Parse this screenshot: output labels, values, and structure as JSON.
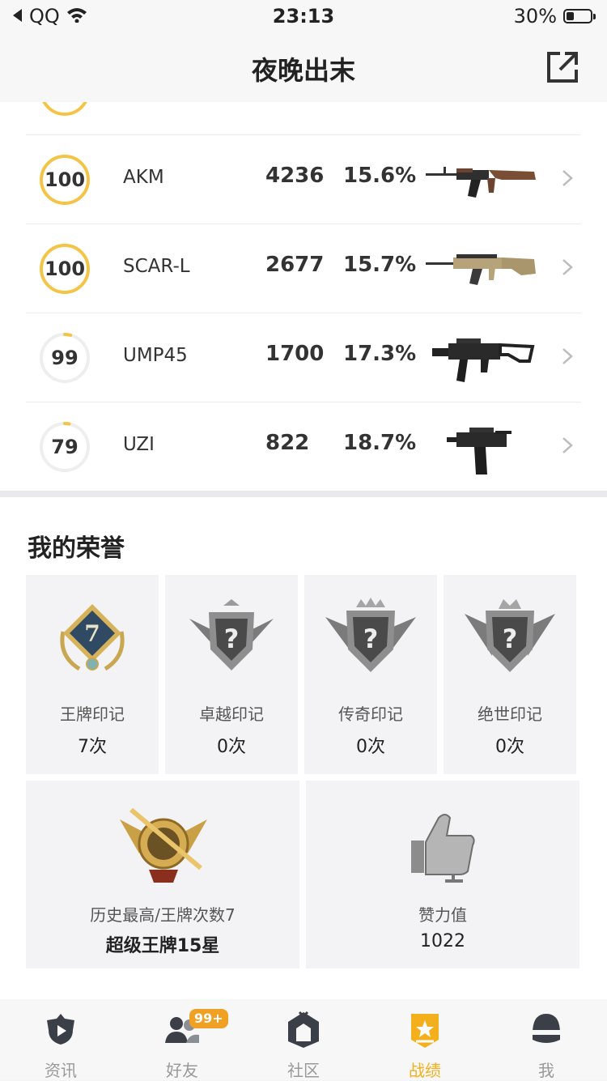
{
  "status_bar": {
    "carrier": "QQ",
    "time": "23:13",
    "battery": "30%"
  },
  "header": {
    "title": "夜晚出末"
  },
  "weapons": [
    {
      "score": "100",
      "name": "AKM",
      "kills": "4236",
      "rate": "15.6%",
      "progress": 1.0
    },
    {
      "score": "100",
      "name": "SCAR-L",
      "kills": "2677",
      "rate": "15.7%",
      "progress": 1.0
    },
    {
      "score": "99",
      "name": "UMP45",
      "kills": "1700",
      "rate": "17.3%",
      "progress": 0.04
    },
    {
      "score": "79",
      "name": "UZI",
      "kills": "822",
      "rate": "18.7%",
      "progress": 0.03
    }
  ],
  "honor": {
    "title": "我的荣誉",
    "marks": [
      {
        "label": "王牌印记",
        "count": "7次",
        "badge_number": "7"
      },
      {
        "label": "卓越印记",
        "count": "0次"
      },
      {
        "label": "传奇印记",
        "count": "0次"
      },
      {
        "label": "绝世印记",
        "count": "0次"
      }
    ],
    "best": {
      "label": "历史最高/王牌次数7",
      "value": "超级王牌15星"
    },
    "likes": {
      "label": "赞力值",
      "value": "1022"
    }
  },
  "tabs": [
    {
      "label": "资讯",
      "icon": "news-icon"
    },
    {
      "label": "好友",
      "icon": "friends-icon",
      "badge": "99+"
    },
    {
      "label": "社区",
      "icon": "community-icon"
    },
    {
      "label": "战绩",
      "icon": "record-icon",
      "active": true
    },
    {
      "label": "我",
      "icon": "profile-icon"
    }
  ],
  "colors": {
    "accent": "#f3b01c",
    "ring_track": "#eeeeee",
    "badge": "#f0a023"
  }
}
